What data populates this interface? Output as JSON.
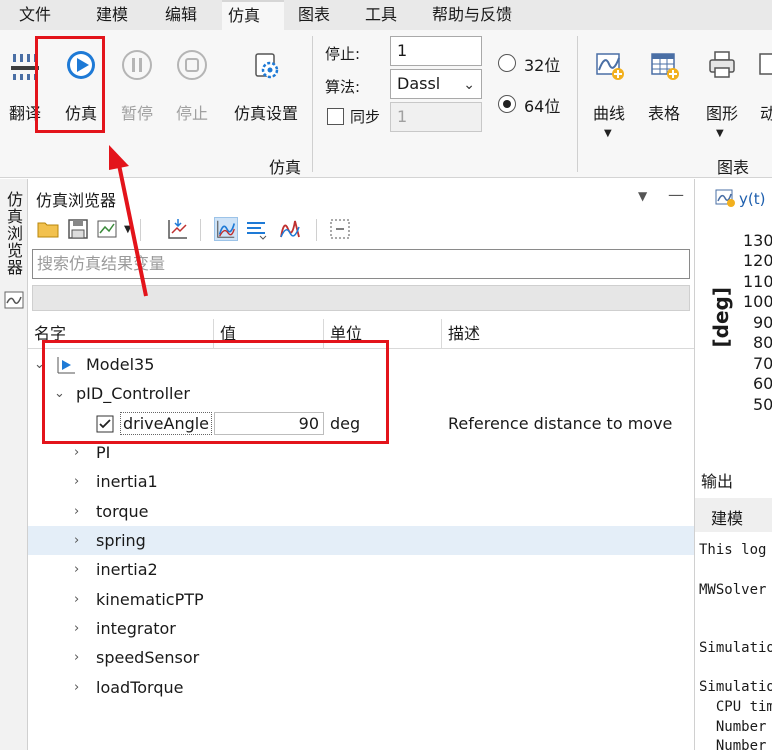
{
  "menu": [
    "文件",
    "建模",
    "编辑",
    "仿真",
    "图表",
    "工具",
    "帮助与反馈"
  ],
  "ribbon": {
    "buttons": {
      "translate": "翻译",
      "simulate": "仿真",
      "pause": "暂停",
      "stop": "停止",
      "sim_settings": "仿真设置"
    },
    "stop_label": "停止:",
    "stop_value": "1",
    "algo_label": "算法:",
    "algo_value": "Dassl",
    "sync_label": "同步",
    "sync_value": "1",
    "bit32": "32位",
    "bit64": "64位",
    "group_sim": "仿真",
    "chart_buttons": {
      "curve": "曲线",
      "table": "表格",
      "graphic": "图形",
      "anim": "动"
    },
    "group_chart": "图表"
  },
  "left_strip_tab": "仿真浏览器",
  "browser": {
    "title": "仿真浏览器",
    "search_placeholder": "搜索仿真结果变量",
    "columns": {
      "name": "名字",
      "value": "值",
      "unit": "单位",
      "desc": "描述"
    },
    "model": "Model35",
    "controller": "pID_Controller",
    "drive": {
      "name": "driveAngle",
      "value": "90",
      "unit": "deg",
      "desc": "Reference distance to move"
    },
    "children": [
      "PI",
      "inertia1",
      "torque",
      "spring",
      "inertia2",
      "kinematicPTP",
      "integrator",
      "speedSensor",
      "loadTorque"
    ]
  },
  "plot": {
    "tab": "y(t)",
    "ylabel": "[deg]",
    "ticks": [
      "130",
      "120",
      "110",
      "100",
      "90",
      "80",
      "70",
      "60",
      "50"
    ]
  },
  "output": {
    "title": "输出",
    "tab": "建模",
    "lines": [
      "This log",
      "MWSolver",
      "Simulatio",
      "Simulatio",
      "  CPU tim",
      "  Number",
      "  Number"
    ]
  }
}
